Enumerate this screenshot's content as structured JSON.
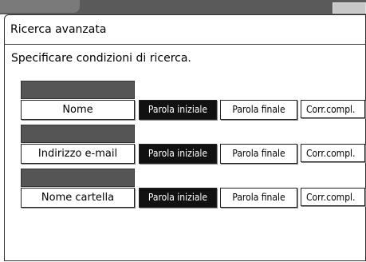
{
  "panel": {
    "title": "Ricerca avanzata",
    "instruction": "Specificare condizioni di ricerca."
  },
  "rows": [
    {
      "field_label": "Nome",
      "options": [
        "Parola iniziale",
        "Parola finale",
        "Corr.compl."
      ],
      "selected": "Parola iniziale"
    },
    {
      "field_label": "Indirizzo e-mail",
      "options": [
        "Parola iniziale",
        "Parola finale",
        "Corr.compl."
      ],
      "selected": "Parola iniziale"
    },
    {
      "field_label": "Nome cartella",
      "options": [
        "Parola iniziale",
        "Parola finale",
        "Corr.compl."
      ],
      "selected": "Parola iniziale"
    }
  ],
  "colors": {
    "value_box": "#555555",
    "selected_bg": "#111111",
    "selected_text": "#ffffff"
  }
}
